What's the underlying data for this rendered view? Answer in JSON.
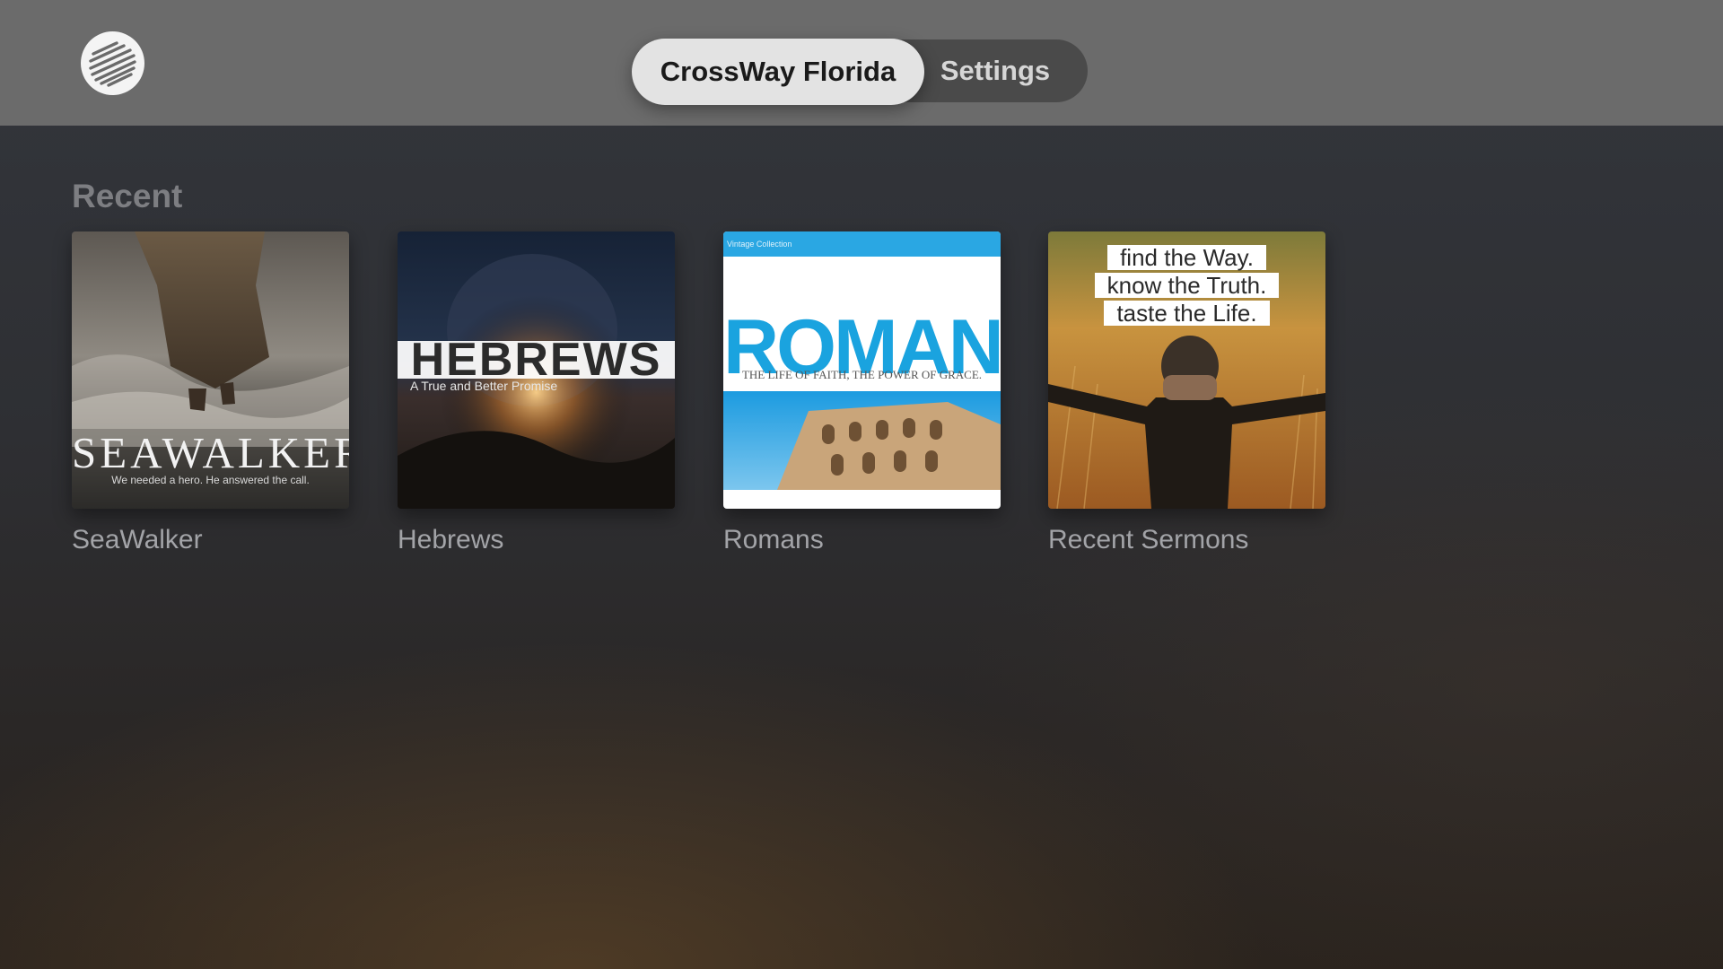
{
  "header": {
    "logo_icon": "crossway-stripes-logo",
    "tabs": [
      {
        "label": "CrossWay Florida",
        "selected": true
      },
      {
        "label": "Settings",
        "selected": false
      }
    ]
  },
  "main": {
    "section_title": "Recent",
    "items": [
      {
        "caption": "SeaWalker",
        "art_title": "SEAWALKER",
        "art_tagline": "We needed a hero. He answered the call."
      },
      {
        "caption": "Hebrews",
        "art_title": "HEBREWS",
        "art_tagline": "A True and Better Promise"
      },
      {
        "caption": "Romans",
        "art_small": "Vintage Collection",
        "art_title": "ROMANS",
        "art_tagline": "THE LIFE OF FAITH, THE POWER OF GRACE."
      },
      {
        "caption": "Recent Sermons",
        "art_lines": [
          "find the Way.",
          "know the Truth.",
          "taste the Life."
        ]
      }
    ]
  },
  "colors": {
    "topbar": "#6b6b6b",
    "tab_active_bg": "#e3e3e3",
    "tab_group_bg": "#4a4a4a",
    "section_title": "#7d7e82",
    "caption": "#a3a4a8"
  }
}
